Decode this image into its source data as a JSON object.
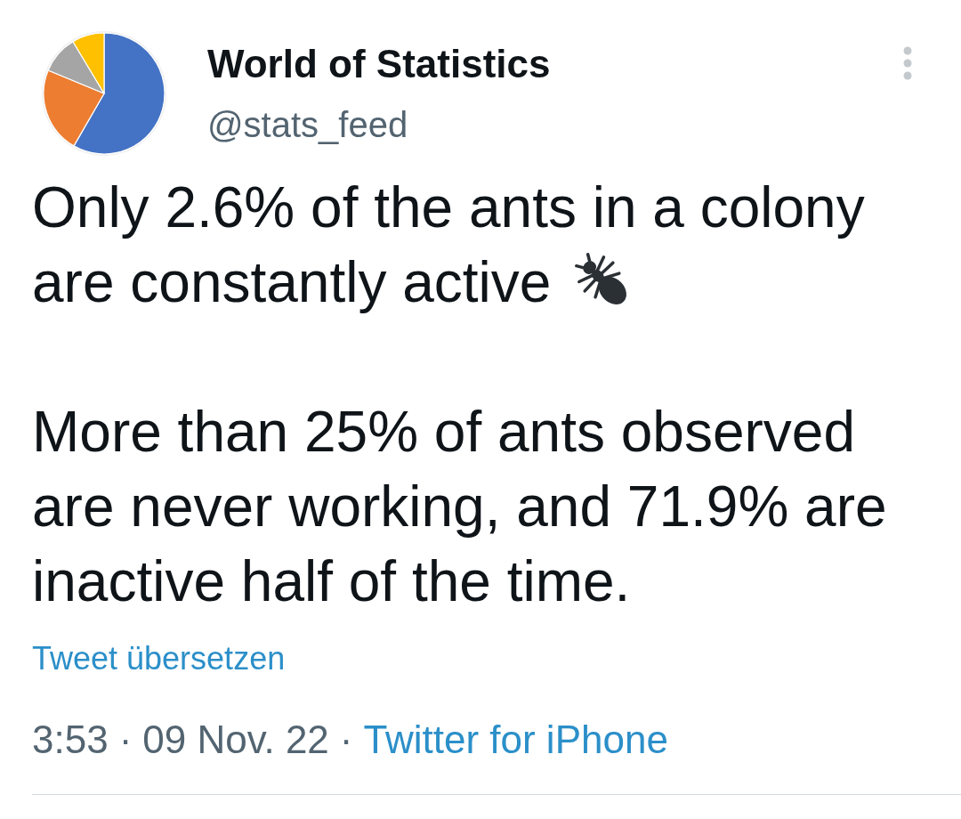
{
  "author": {
    "name": "World of Statistics",
    "handle": "@stats_feed"
  },
  "tweet": {
    "paragraphs": [
      {
        "kind": "with-emoji",
        "lines": [
          "Only 2.6% of the ants in a colony",
          "are constantly active"
        ]
      },
      {
        "kind": "plain",
        "text": "More than 25% of ants observed are never working, and 71.9% are inactive half of the time."
      }
    ],
    "translate_link": "Tweet übersetzen",
    "meta": [
      {
        "kind": "time",
        "text": "3:53"
      },
      {
        "kind": "separator",
        "text": "·"
      },
      {
        "kind": "date",
        "text": "09 Nov. 22"
      },
      {
        "kind": "separator",
        "text": "·"
      },
      {
        "kind": "source",
        "text": "Twitter for iPhone"
      }
    ]
  }
}
